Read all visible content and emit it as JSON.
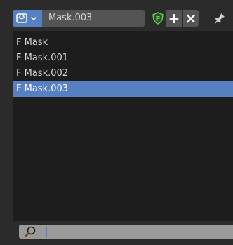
{
  "header": {
    "active_mask_name": "Mask.003",
    "mask_type_icon": "mask-datablock-icon",
    "dropdown_icon": "chevron-down-icon",
    "fake_user_icon": "shield-icon",
    "add_label": "+",
    "unlink_label": "×",
    "pin_icon": "pin-icon"
  },
  "list": {
    "items": [
      {
        "label": "F Mask",
        "selected": false
      },
      {
        "label": "F Mask.001",
        "selected": false
      },
      {
        "label": "F Mask.002",
        "selected": false
      },
      {
        "label": "F Mask.003",
        "selected": true
      }
    ]
  },
  "search": {
    "icon": "search-icon",
    "value": "",
    "placeholder": ""
  },
  "colors": {
    "background": "#2b2b2b",
    "list_background": "#1d1d1d",
    "selection": "#5680c2",
    "field": "#545454",
    "text": "#d6d6d6",
    "fake_user_green": "#66cc55"
  }
}
